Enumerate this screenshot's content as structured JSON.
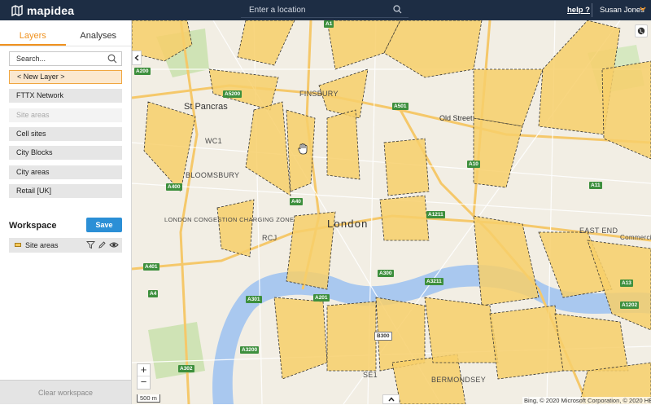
{
  "app": {
    "name": "mapidea",
    "search_placeholder": "Enter a location",
    "help_label": "help ?",
    "user_name": "Susan Jones"
  },
  "sidebar": {
    "tabs": [
      {
        "label": "Layers",
        "active": true
      },
      {
        "label": "Analyses",
        "active": false
      }
    ],
    "search_placeholder": "Search...",
    "new_layer_label": "< New Layer >",
    "layers": [
      {
        "label": "FTTX Network",
        "enabled": true
      },
      {
        "label": "Site areas",
        "enabled": false
      },
      {
        "label": "Cell sites",
        "enabled": true
      },
      {
        "label": "City Blocks",
        "enabled": true
      },
      {
        "label": "City areas",
        "enabled": true
      },
      {
        "label": "Retail [UK]",
        "enabled": true
      }
    ],
    "workspace": {
      "title": "Workspace",
      "save_label": "Save",
      "items": [
        {
          "label": "Site areas"
        }
      ]
    },
    "clear_label": "Clear workspace"
  },
  "map": {
    "scale_label": "500 m",
    "attribution": "Bing, © 2020 Microsoft Corporation, © 2020 HERE",
    "zoom_in": "+",
    "zoom_out": "−",
    "area_labels": [
      "St Pancras",
      "WC1",
      "BLOOMSBURY",
      "LONDON CONGESTION CHARGING ZONE",
      "RCJ",
      "London",
      "EAST END",
      "FINSBURY",
      "Old Street",
      "SE1",
      "BERMONDSEY",
      "Commercial"
    ],
    "road_labels": [
      "A1",
      "A501",
      "A5200",
      "A200",
      "A400",
      "A40",
      "A1211",
      "A10",
      "A11",
      "A13",
      "A1202",
      "A3211",
      "A201",
      "A300",
      "A301",
      "A4",
      "A401",
      "A302",
      "A3200",
      "B300"
    ]
  },
  "colors": {
    "topbar": "#1d2d44",
    "accent": "#f0921f",
    "save": "#2b8fd6",
    "polygon_fill": "#f7cf6a"
  }
}
